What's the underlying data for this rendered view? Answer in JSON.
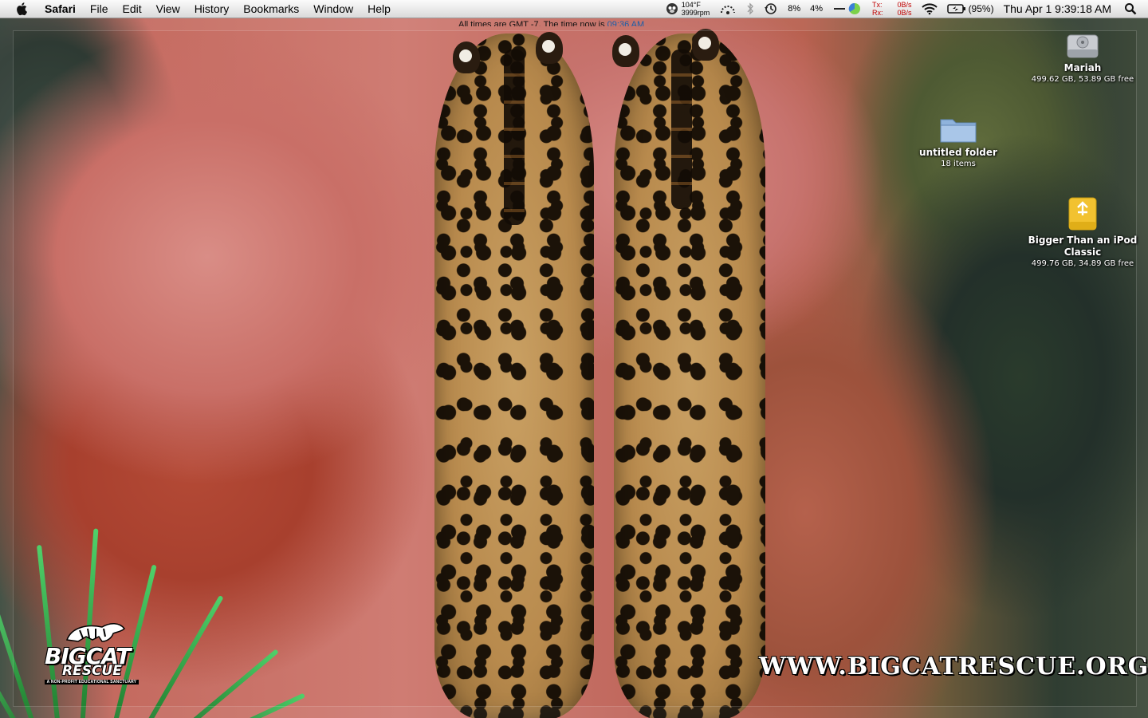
{
  "menubar": {
    "app_name": "Safari",
    "items": [
      "File",
      "Edit",
      "View",
      "History",
      "Bookmarks",
      "Window",
      "Help"
    ],
    "status": {
      "temperature": "104°F",
      "fan_speed": "3999rpm",
      "cpu1": "8%",
      "cpu2": "4%",
      "tx_label": "Tx:",
      "rx_label": "Rx:",
      "tx_rate": "0B/s",
      "rx_rate": "0B/s",
      "battery": "(95%)",
      "clock": "Thu Apr 1  9:39:18 AM"
    }
  },
  "ticker": {
    "label": "All times are GMT -7. The time now is",
    "time": "09:36 AM"
  },
  "desktop": {
    "icons": [
      {
        "name": "Mariah",
        "info": "499.62 GB, 53.89 GB free",
        "icon": "hard-drive-icon"
      },
      {
        "name": "untitled folder",
        "info": "18 items",
        "icon": "folder-icon"
      },
      {
        "name": "Bigger Than an iPod Classic",
        "info": "499.76 GB, 34.89 GB free",
        "icon": "external-drive-icon"
      }
    ]
  },
  "wallpaper": {
    "url_text": "WWW.BIGCATRESCUE.ORG",
    "logo_line1": "BIGCAT",
    "logo_line2": "RESCUE",
    "logo_tagline": "A NON-PROFIT EDUCATIONAL SANCTUARY"
  },
  "colors": {
    "accent_time": "#1a5ea8",
    "tx_color": "#c00000",
    "rx_color": "#008000"
  }
}
